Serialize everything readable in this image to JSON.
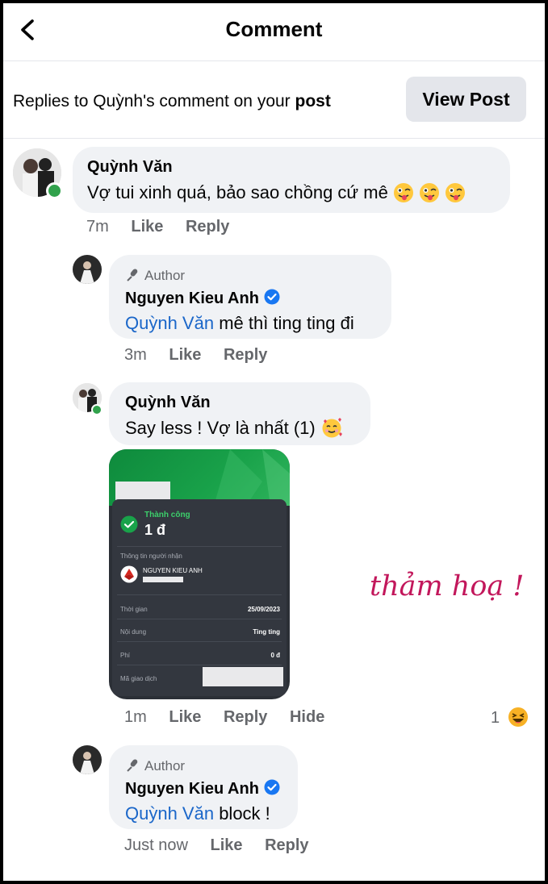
{
  "header": {
    "title": "Comment"
  },
  "replies_bar": {
    "prefix": "Replies to Quỳnh's comment on your ",
    "post_word": "post",
    "view_post_label": "View Post"
  },
  "comments": [
    {
      "name": "Quỳnh Văn",
      "text": "Vợ tui xinh quá, bảo sao chồng cứ mê",
      "time": "7m",
      "like": "Like",
      "reply": "Reply"
    },
    {
      "author_tag": "Author",
      "name": "Nguyen Kieu Anh",
      "mention": "Quỳnh Văn",
      "text": " mê thì ting ting đi",
      "time": "3m",
      "like": "Like",
      "reply": "Reply"
    },
    {
      "name": "Quỳnh Văn",
      "text": "Say less ! Vợ là nhất (1)",
      "time": "1m",
      "like": "Like",
      "reply": "Reply",
      "hide": "Hide",
      "reaction_count": "1"
    },
    {
      "author_tag": "Author",
      "name": "Nguyen Kieu Anh",
      "mention": "Quỳnh Văn",
      "text": " block !",
      "time": "Just now",
      "like": "Like",
      "reply": "Reply"
    }
  ],
  "receipt": {
    "status": "Thành công",
    "amount": "1 đ",
    "recipient_label": "Thông tin người nhận",
    "recipient_name": "NGUYEN KIEU ANH",
    "time_label": "Thời gian",
    "time_value": "25/09/2023",
    "content_label": "Nội dung",
    "content_value": "Ting ting",
    "fee_label": "Phí",
    "fee_value": "0 đ",
    "code_label": "Mã giao dịch"
  },
  "annotation": "thảm hoạ !",
  "colors": {
    "mention": "#1a66c9",
    "verified": "#1877f2",
    "online": "#31a24c",
    "annotation": "#c2175b",
    "success": "#19a24a"
  }
}
